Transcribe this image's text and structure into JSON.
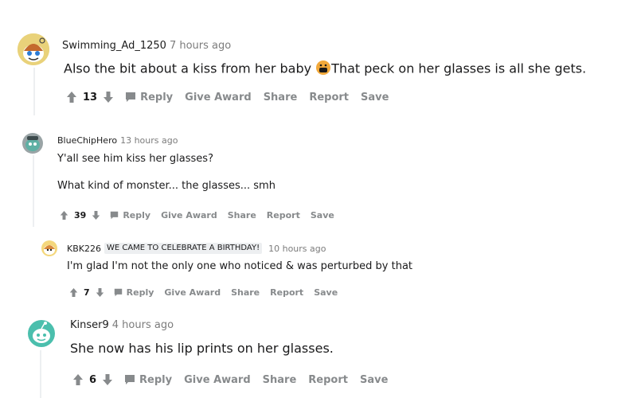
{
  "colors": {
    "action_gray": "#878a8c",
    "thread_line": "#edeff1",
    "text": "#1a1a1b",
    "timestamp": "#7c7c7c",
    "flair_bg": "#edeff1"
  },
  "comments": [
    {
      "username": "Swimming_Ad_1250",
      "timestamp": "7 hours ago",
      "body": [
        "Also the bit about a kiss from her baby",
        "That peck on her glasses is all she gets."
      ],
      "emoji": "face-with-symbols-on-mouth",
      "score": "13",
      "actions": {
        "reply": "Reply",
        "award": "Give Award",
        "share": "Share",
        "report": "Report",
        "save": "Save"
      }
    },
    {
      "username": "BlueChipHero",
      "timestamp": "13 hours ago",
      "body": [
        "Y'all see him kiss her glasses?",
        "What kind of monster... the glasses... smh"
      ],
      "score": "39",
      "actions": {
        "reply": "Reply",
        "award": "Give Award",
        "share": "Share",
        "report": "Report",
        "save": "Save"
      }
    },
    {
      "username": "KBK226",
      "flair": "WE CAME TO CELEBRATE A BIRTHDAY!",
      "timestamp": "10 hours ago",
      "body": [
        "I'm glad I'm not the only one who noticed & was perturbed by that"
      ],
      "score": "7",
      "actions": {
        "reply": "Reply",
        "award": "Give Award",
        "share": "Share",
        "report": "Report",
        "save": "Save"
      }
    },
    {
      "username": "Kinser9",
      "timestamp": "4 hours ago",
      "body": [
        "She now has his lip prints on her glasses."
      ],
      "score": "6",
      "actions": {
        "reply": "Reply",
        "award": "Give Award",
        "share": "Share",
        "report": "Report",
        "save": "Save"
      }
    }
  ]
}
